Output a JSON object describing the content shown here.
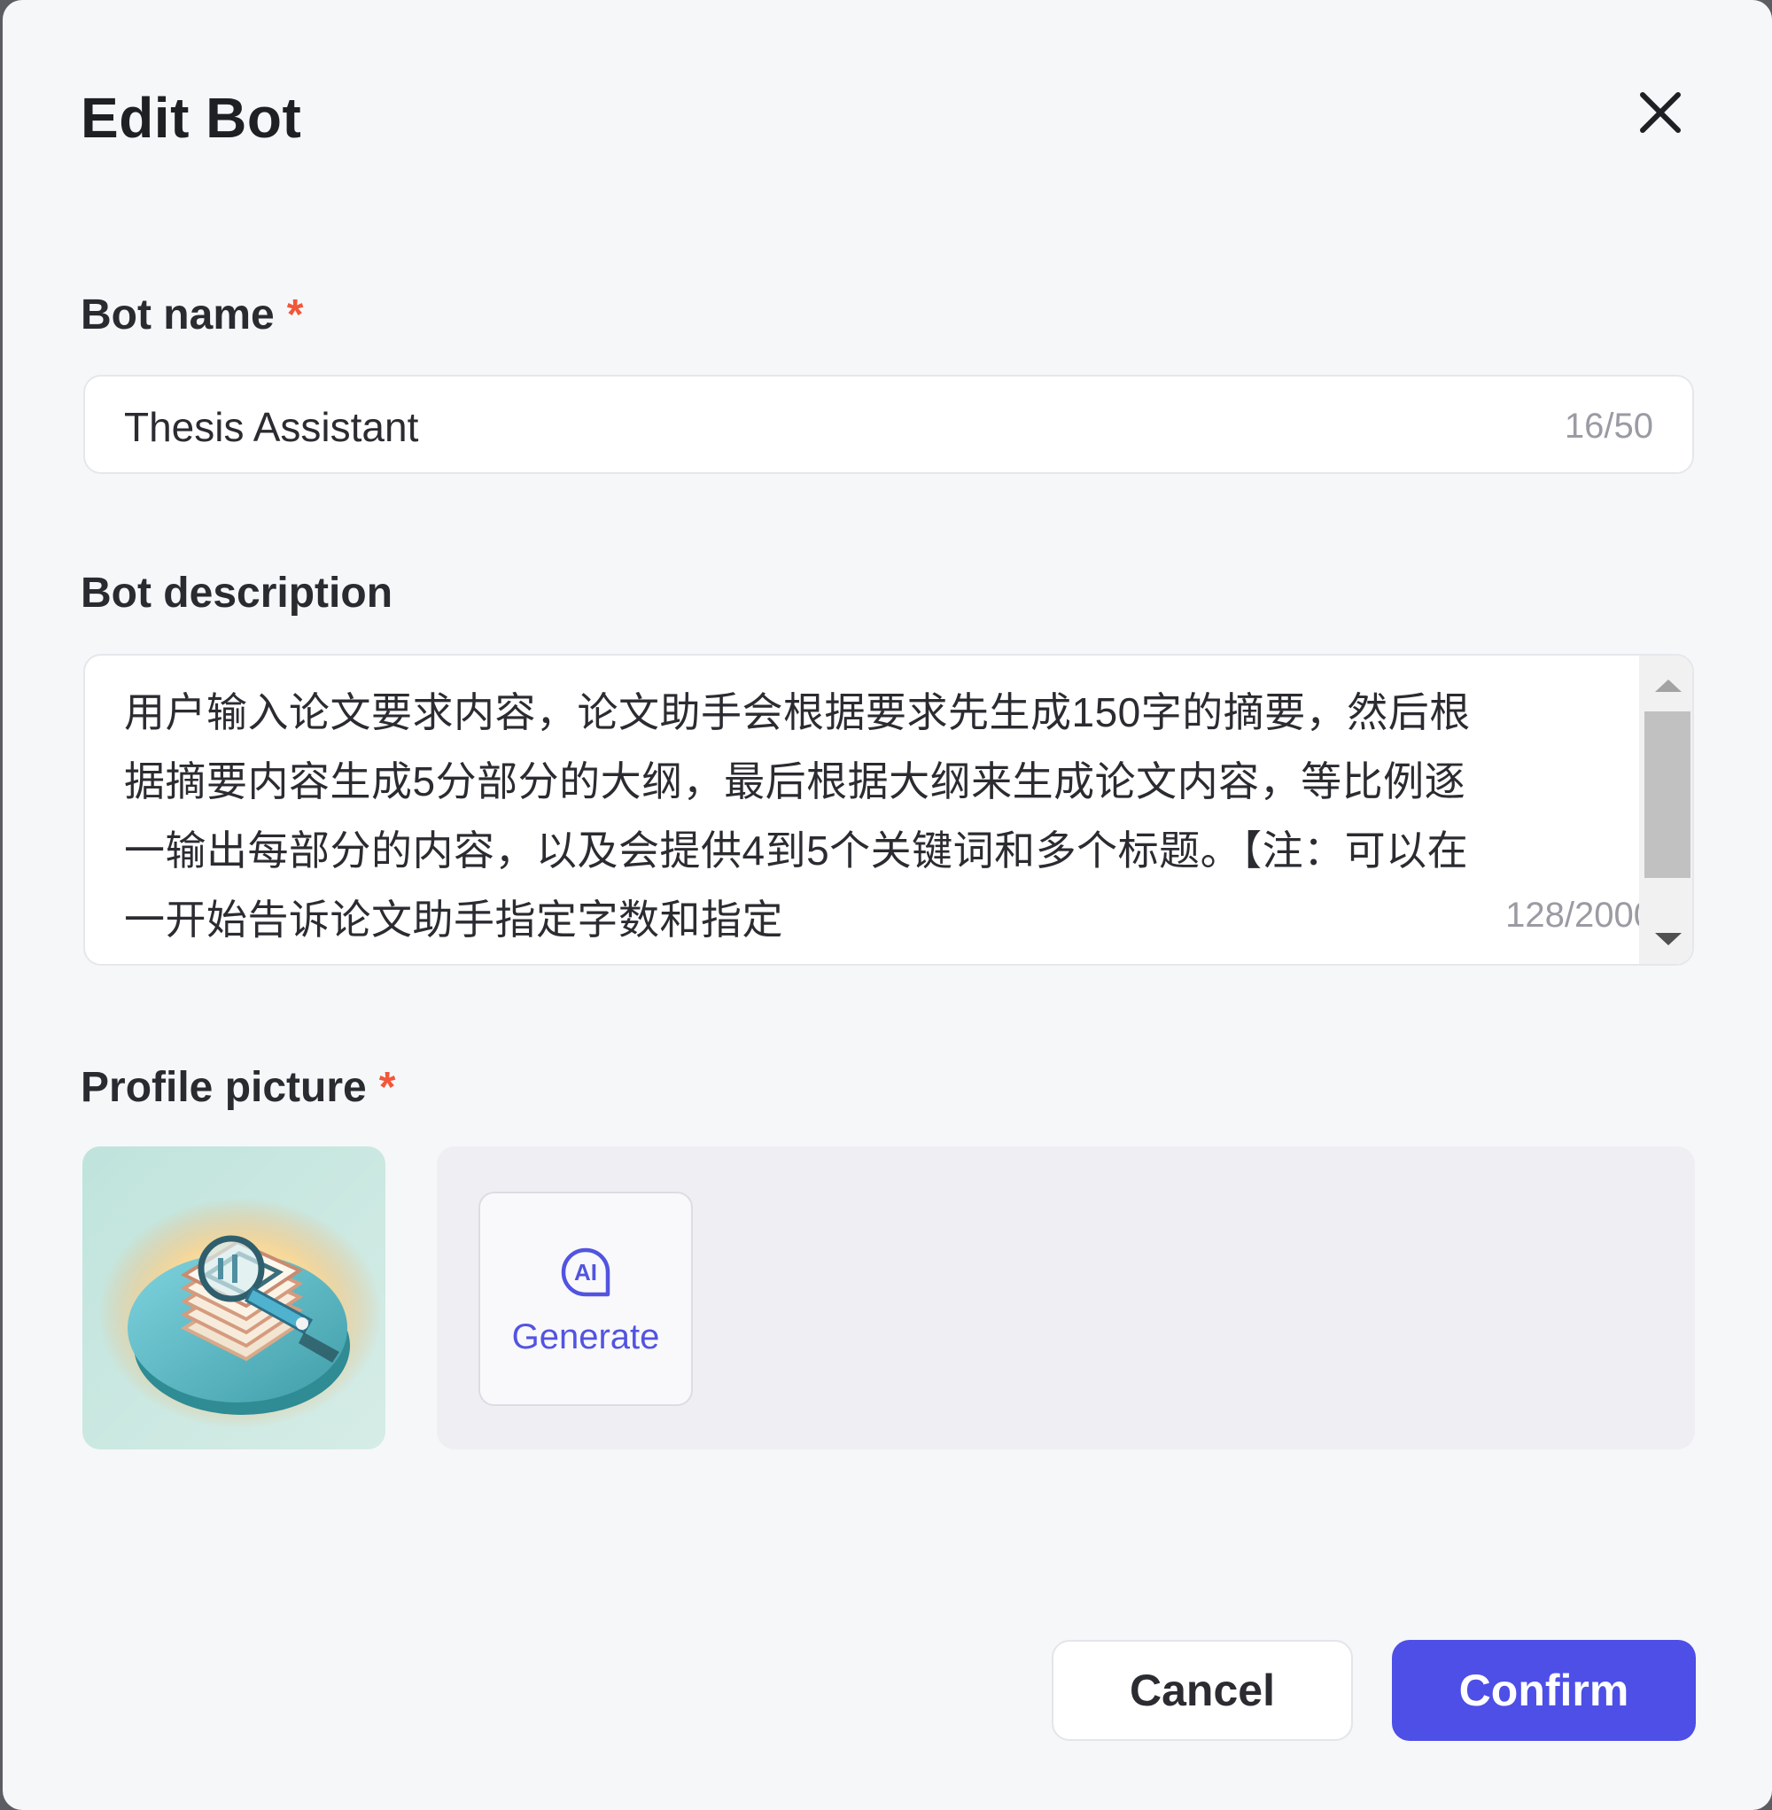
{
  "dialog": {
    "title": "Edit Bot"
  },
  "bot_name": {
    "label": "Bot name",
    "required_mark": "*",
    "value": "Thesis Assistant",
    "counter": "16/50"
  },
  "bot_description": {
    "label": "Bot description",
    "value": "用户输入论文要求内容，论文助手会根据要求先生成150字的摘要，然后根据摘要内容生成5分部分的大纲，最后根据大纲来生成论文内容，等比例逐一输出每部分的内容，以及会提供4到5个关键词和多个标题。【注：可以在一开始告诉论文助手指定字数和指定",
    "counter": "128/2000"
  },
  "profile_picture": {
    "label": "Profile picture",
    "required_mark": "*",
    "generate_label": "Generate",
    "generate_icon": "ai-generate-icon",
    "avatar_icon": "document-magnifier-illustration"
  },
  "actions": {
    "cancel_label": "Cancel",
    "confirm_label": "Confirm"
  },
  "colors": {
    "accent": "#4d4fe6",
    "required": "#f2573a",
    "dialog_background": "#f6f7f9"
  }
}
